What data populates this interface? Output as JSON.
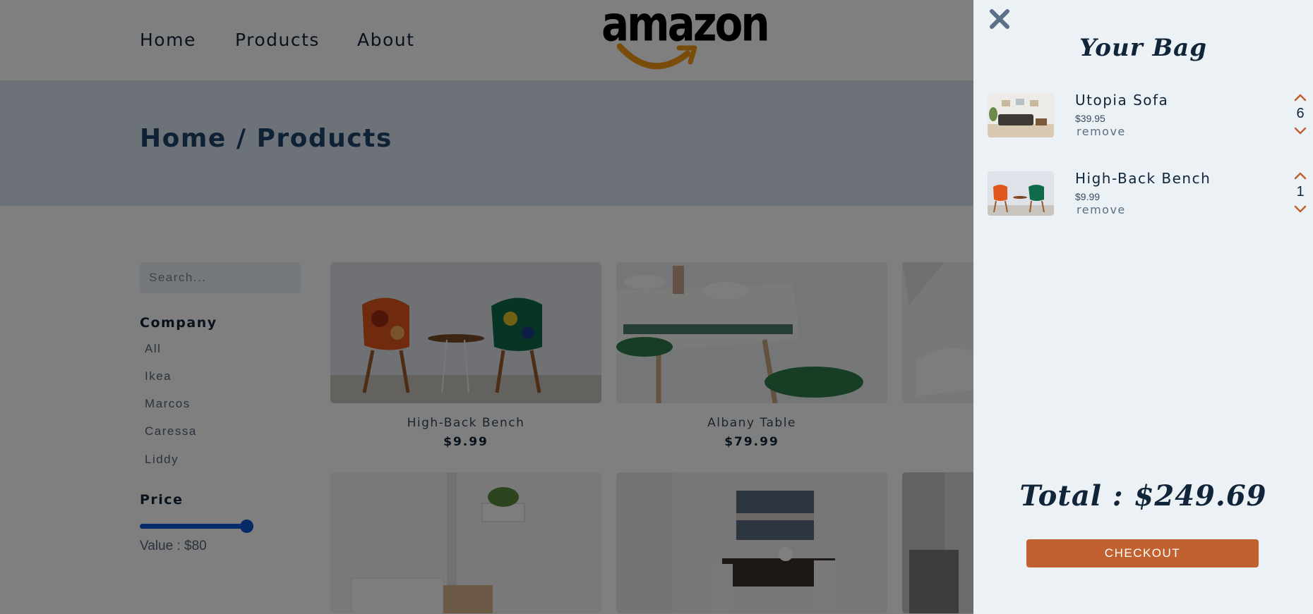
{
  "nav": {
    "links": [
      "Home",
      "Products",
      "About"
    ],
    "logo_text": "amazon"
  },
  "hero": {
    "title": "Home / Products"
  },
  "filters": {
    "search_placeholder": "Search...",
    "company_title": "Company",
    "companies": [
      "All",
      "Ikea",
      "Marcos",
      "Caressa",
      "Liddy"
    ],
    "price_title": "Price",
    "price_value_label": "Value : $80",
    "price_slider_value": 80,
    "price_slider_fraction": 1.0
  },
  "products": [
    {
      "name": "High-Back Bench",
      "price": "$9.99"
    },
    {
      "name": "Albany Table",
      "price": "$79.99"
    }
  ],
  "cart": {
    "title": "Your Bag",
    "items": [
      {
        "name": "Utopia Sofa",
        "price": "$39.95",
        "remove_label": "remove",
        "amount": "6"
      },
      {
        "name": "High-Back Bench",
        "price": "$9.99",
        "remove_label": "remove",
        "amount": "1"
      }
    ],
    "total": "Total : $249.69",
    "checkout_label": "CHECKOUT"
  },
  "colors": {
    "accent": "#c0612f",
    "slider": "#0b57d0",
    "primary_text": "#10253a",
    "hero_bg": "#dae5f3",
    "cart_bg": "#ecf1f6",
    "logo_smile": "#f29a12"
  },
  "icons": {
    "close": "close-x-icon",
    "qty_increase": "chevron-up-icon",
    "qty_decrease": "chevron-down-icon"
  }
}
